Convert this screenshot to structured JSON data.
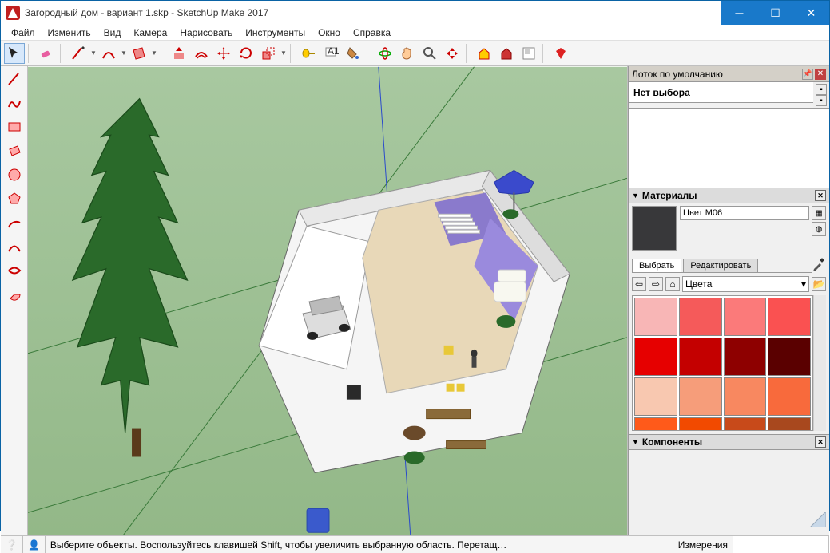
{
  "window": {
    "title": "Загородный дом - вариант 1.skp - SketchUp Make 2017"
  },
  "menu": [
    "Файл",
    "Изменить",
    "Вид",
    "Камера",
    "Нарисовать",
    "Инструменты",
    "Окно",
    "Справка"
  ],
  "tray": {
    "title": "Лоток по умолчанию"
  },
  "entity": {
    "label": "Нет выбора"
  },
  "materials": {
    "header": "Материалы",
    "name": "Цвет M06",
    "tab_select": "Выбрать",
    "tab_edit": "Редактировать",
    "combo": "Цвета",
    "swatches": [
      "#f8b6b6",
      "#f55a5a",
      "#fb7a7a",
      "#fa5151",
      "#e60000",
      "#c40000",
      "#8e0000",
      "#5a0000",
      "#f8c8b0",
      "#f69d7a",
      "#f88860",
      "#f86a3c",
      "#ff5a1a",
      "#f24a00",
      "#c84a1a",
      "#a8481e"
    ]
  },
  "components": {
    "header": "Компоненты"
  },
  "status": {
    "text": "Выберите объекты. Воспользуйтесь клавишей Shift, чтобы увеличить выбранную область. Перетащ…",
    "label": "Измерения"
  }
}
